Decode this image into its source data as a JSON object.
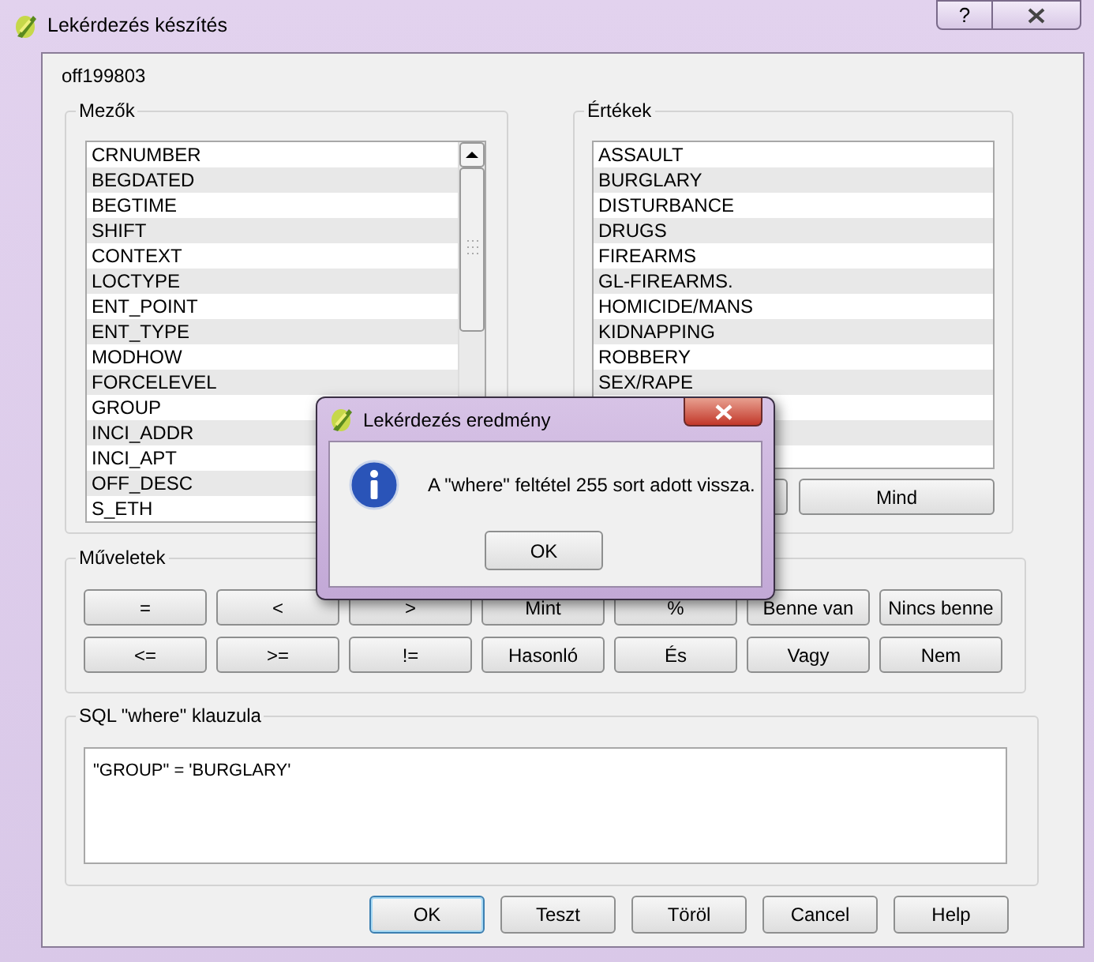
{
  "window": {
    "title": "Lekérdezés készítés",
    "help_button": "?"
  },
  "layer_name": "off199803",
  "fields": {
    "title": "Mezők",
    "items": [
      "CRNUMBER",
      "BEGDATED",
      "BEGTIME",
      "SHIFT",
      "CONTEXT",
      "LOCTYPE",
      "ENT_POINT",
      "ENT_TYPE",
      "MODHOW",
      "FORCELEVEL",
      "GROUP",
      "INCI_ADDR",
      "INCI_APT",
      "OFF_DESC",
      "S_ETH"
    ]
  },
  "values": {
    "title": "Értékek",
    "items": [
      "ASSAULT",
      "BURGLARY",
      "DISTURBANCE",
      "DRUGS",
      "FIREARMS",
      "GL-FIREARMS.",
      "HOMICIDE/MANS",
      "KIDNAPPING",
      "ROBBERY",
      "SEX/RAPE"
    ],
    "buttons": [
      "Mind"
    ]
  },
  "operators": {
    "title": "Műveletek",
    "buttons": [
      "=",
      "<",
      ">",
      "Mint",
      "%",
      "Benne van",
      "Nincs benne",
      "<=",
      ">=",
      "!=",
      "Hasonló",
      "És",
      "Vagy",
      "Nem"
    ]
  },
  "sql": {
    "title": "SQL \"where\" klauzula",
    "value": "\"GROUP\" = 'BURGLARY'"
  },
  "buttons": [
    {
      "label": "OK",
      "default": true
    },
    {
      "label": "Teszt",
      "default": false
    },
    {
      "label": "Töröl",
      "default": false
    },
    {
      "label": "Cancel",
      "default": false
    },
    {
      "label": "Help",
      "default": false
    }
  ],
  "message_box": {
    "title": "Lekérdezés eredmény",
    "text": "A \"where\" feltétel 255 sort adott vissza.",
    "button": "OK"
  }
}
